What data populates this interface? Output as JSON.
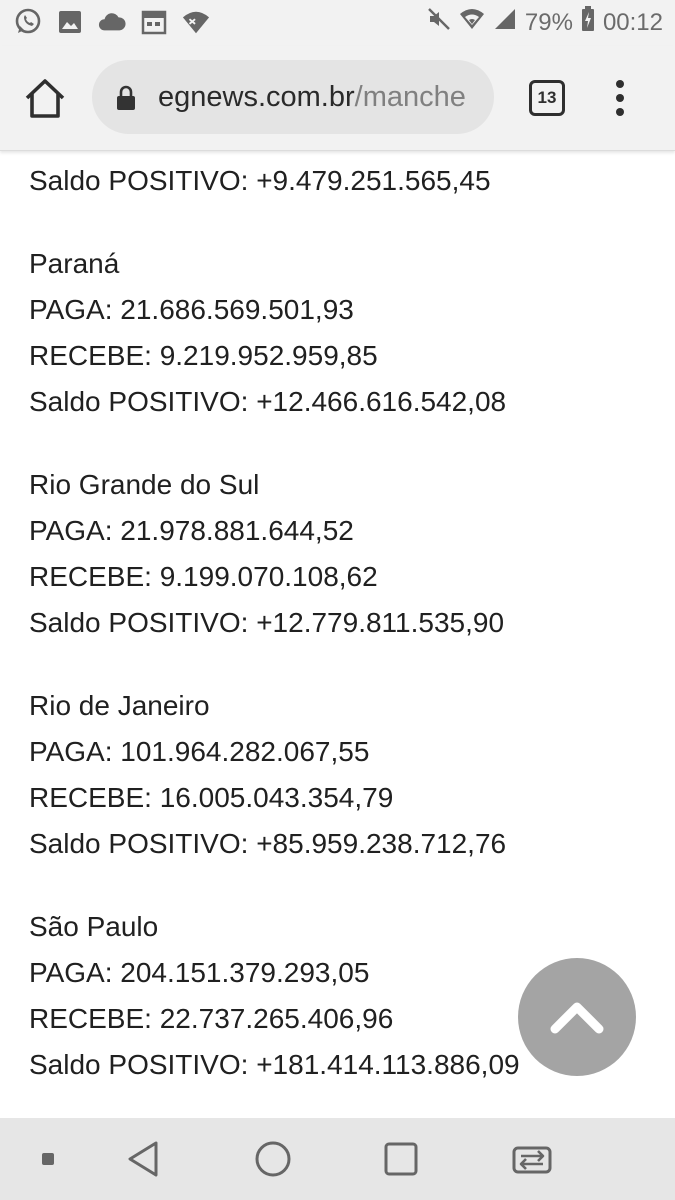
{
  "status_bar": {
    "battery": "79%",
    "time": "00:12",
    "left_icons": [
      "whatsapp-icon",
      "image-icon",
      "cloud-icon",
      "calendar-icon",
      "wifi-locked-icon"
    ],
    "right_icons": [
      "mute-icon",
      "wifi-icon",
      "signal-icon",
      "battery-charging-icon"
    ]
  },
  "browser": {
    "url_domain": "egnews.com.br",
    "url_path": "/manche",
    "tab_count": "13"
  },
  "content": {
    "top_line": "Saldo POSITIVO: +9.479.251.565,45",
    "states": [
      {
        "name": "Paraná",
        "paga": "PAGA: 21.686.569.501,93",
        "recebe": "RECEBE: 9.219.952.959,85",
        "saldo": "Saldo POSITIVO: +12.466.616.542,08"
      },
      {
        "name": "Rio Grande do Sul",
        "paga": "PAGA: 21.978.881.644,52",
        "recebe": "RECEBE: 9.199.070.108,62",
        "saldo": "Saldo POSITIVO: +12.779.811.535,90"
      },
      {
        "name": "Rio de Janeiro",
        "paga": "PAGA: 101.964.282.067,55",
        "recebe": "RECEBE: 16.005.043.354,79",
        "saldo": "Saldo POSITIVO: +85.959.238.712,76"
      },
      {
        "name": "São Paulo",
        "paga": "PAGA: 204.151.379.293,05",
        "recebe": "RECEBE: 22.737.265.406,96",
        "saldo": "Saldo POSITIVO: +181.414.113.886,09"
      }
    ]
  },
  "colors": {
    "status_bg": "#f2f2f2",
    "toolbar_bg": "#f2f2f2",
    "urlbar_bg": "#e4e4e4",
    "fab_bg": "#9e9e9e",
    "navbar_bg": "#e6e6e6"
  }
}
